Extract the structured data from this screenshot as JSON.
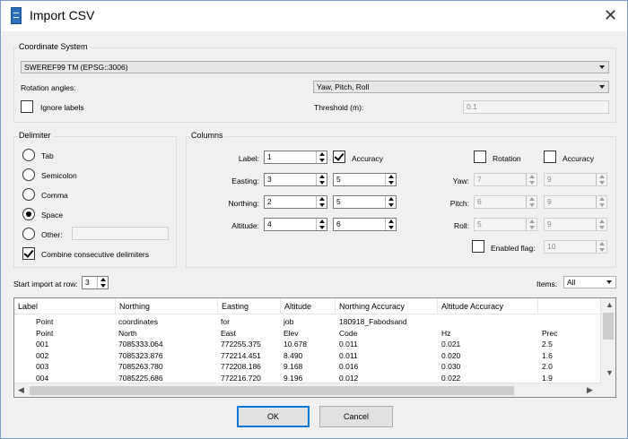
{
  "window": {
    "title": "Import CSV",
    "close_glyph": "✕"
  },
  "coordinate_system": {
    "group_label": "Coordinate System",
    "selected": "SWEREF99 TM (EPSG::3006)",
    "rotation_label": "Rotation angles:",
    "rotation_value": "Yaw, Pitch, Roll",
    "ignore_labels": "Ignore labels",
    "threshold_label": "Threshold (m):",
    "threshold_value": "0.1"
  },
  "delimiter": {
    "group_label": "Delimiter",
    "options": [
      "Tab",
      "Semicolon",
      "Comma",
      "Space",
      "Other:"
    ],
    "selected": "Space",
    "other_value": "",
    "combine": "Combine consecutive delimiters"
  },
  "columns": {
    "group_label": "Columns",
    "label": {
      "label": "Label:",
      "value": "1"
    },
    "easting": {
      "label": "Easting:",
      "value": "3",
      "acc": "5"
    },
    "northing": {
      "label": "Northing:",
      "value": "2",
      "acc": "5"
    },
    "altitude": {
      "label": "Altitude:",
      "value": "4",
      "acc": "6"
    },
    "accuracy_label": "Accuracy",
    "rotation_label": "Rotation",
    "rot_accuracy_label": "Accuracy",
    "yaw": {
      "label": "Yaw:",
      "value": "7",
      "acc": "9"
    },
    "pitch": {
      "label": "Pitch:",
      "value": "6",
      "acc": "9"
    },
    "roll": {
      "label": "Roll:",
      "value": "5",
      "acc": "9"
    },
    "enabled_flag": {
      "label": "Enabled flag:",
      "value": "10"
    }
  },
  "import": {
    "start_label": "Start import at row:",
    "start_value": "3",
    "items_label": "Items:",
    "items_value": "All"
  },
  "table": {
    "headers": [
      "Label",
      "Northing",
      "Easting",
      "Altitude",
      "Northing Accuracy",
      "Altitude Accuracy"
    ],
    "rows": [
      [
        "Point",
        "coordinates",
        "for",
        "job",
        "180918_Fabodsand",
        "",
        ""
      ],
      [
        "Point",
        "North",
        "East",
        "Elev",
        "Code",
        "Hz",
        "Prec"
      ],
      [
        "001",
        "7085333.064",
        "772255.375",
        "10.678",
        "0.011",
        "0.021",
        "2.5"
      ],
      [
        "002",
        "7085323.876",
        "772214.451",
        "8.490",
        "0.011",
        "0.020",
        "1.6"
      ],
      [
        "003",
        "7085263.780",
        "772208.186",
        "9.168",
        "0.016",
        "0.030",
        "2.0"
      ],
      [
        "004",
        "7085225.686",
        "772216.720",
        "9.196",
        "0.012",
        "0.022",
        "1.9"
      ]
    ]
  },
  "buttons": {
    "ok": "OK",
    "cancel": "Cancel"
  }
}
